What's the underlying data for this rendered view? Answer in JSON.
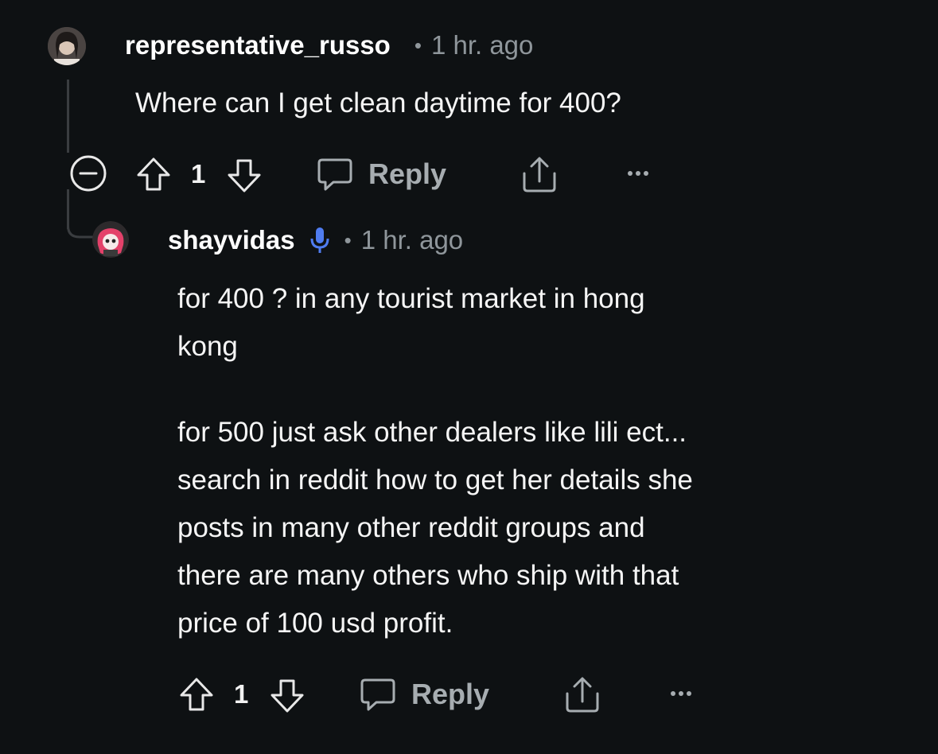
{
  "comments": [
    {
      "username": "representative_russo",
      "time": "1 hr. ago",
      "body": "Where can I get clean daytime for 400?",
      "votes": "1",
      "reply_label": "Reply"
    },
    {
      "username": "shayvidas",
      "time": "1 hr. ago",
      "body_lines": [
        "for 400 ? in any tourist market in hong",
        "kong",
        "",
        "for 500 just ask other dealers like lili ect...",
        "search in reddit how to get her details she",
        "posts in many other reddit groups and",
        "there are many others who ship with that",
        "price of 100 usd profit."
      ],
      "votes": "1",
      "reply_label": "Reply"
    }
  ],
  "separator": "•",
  "colors": {
    "background": "#0e1113",
    "meta": "#8f969b",
    "mic_badge": "#4f7cf0",
    "thread_line": "#3a3d40"
  }
}
